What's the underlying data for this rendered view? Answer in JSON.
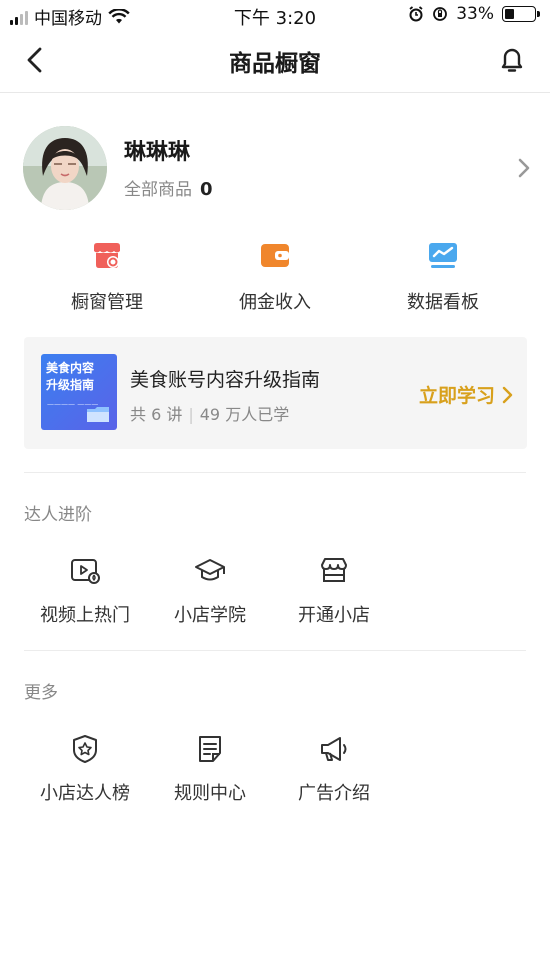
{
  "status_bar": {
    "carrier": "中国移动",
    "time": "下午 3:20",
    "battery": "33%",
    "battery_level": 0.33
  },
  "nav": {
    "title": "商品橱窗"
  },
  "profile": {
    "name": "琳琳琳",
    "all_products_label": "全部商品",
    "all_products_count": "0"
  },
  "quick_actions": [
    {
      "label": "橱窗管理",
      "icon": "store-settings-icon",
      "color": "#f0605a"
    },
    {
      "label": "佣金收入",
      "icon": "wallet-icon",
      "color": "#f0862c"
    },
    {
      "label": "数据看板",
      "icon": "chart-board-icon",
      "color": "#4aa8ee"
    }
  ],
  "course": {
    "thumb_text_line1": "美食内容",
    "thumb_text_line2": "升级指南",
    "title": "美食账号内容升级指南",
    "lessons": "共 6 讲",
    "learners": "49 万人已学",
    "cta": "立即学习"
  },
  "sections": {
    "advance": {
      "title": "达人进阶",
      "items": [
        {
          "label": "视频上热门",
          "icon": "video-hot-icon"
        },
        {
          "label": "小店学院",
          "icon": "graduation-cap-icon"
        },
        {
          "label": "开通小店",
          "icon": "shop-icon"
        }
      ]
    },
    "more": {
      "title": "更多",
      "items": [
        {
          "label": "小店达人榜",
          "icon": "badge-icon"
        },
        {
          "label": "规则中心",
          "icon": "document-icon"
        },
        {
          "label": "广告介绍",
          "icon": "megaphone-icon"
        }
      ]
    }
  },
  "colors": {
    "accent_gold": "#d8a01c",
    "card_bg": "#f5f5f5"
  }
}
